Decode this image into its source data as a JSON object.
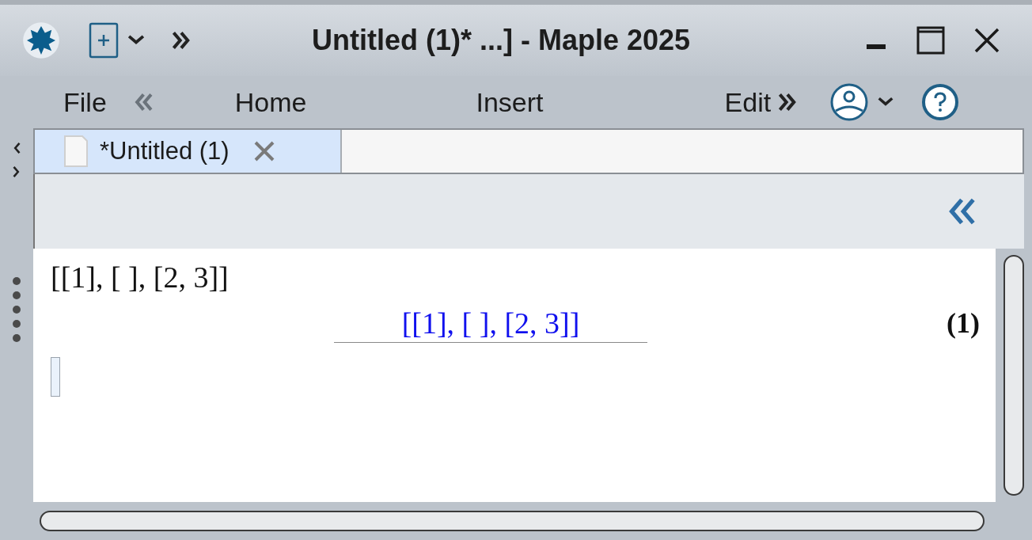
{
  "window": {
    "title": "Untitled (1)* ...] - Maple 2025"
  },
  "ribbon": {
    "tabs": [
      {
        "label": "File",
        "selected": false
      },
      {
        "label": "Home",
        "selected": false
      },
      {
        "label": "Insert",
        "selected": false
      },
      {
        "label": "Edit",
        "selected": false
      }
    ]
  },
  "document_tabs": [
    {
      "label": "*Untitled (1)",
      "selected": true
    }
  ],
  "worksheet": {
    "input": "[[1], [ ], [2, 3]]",
    "output": "[[1], [ ], [2, 3]]",
    "equation_label": "(1)"
  }
}
